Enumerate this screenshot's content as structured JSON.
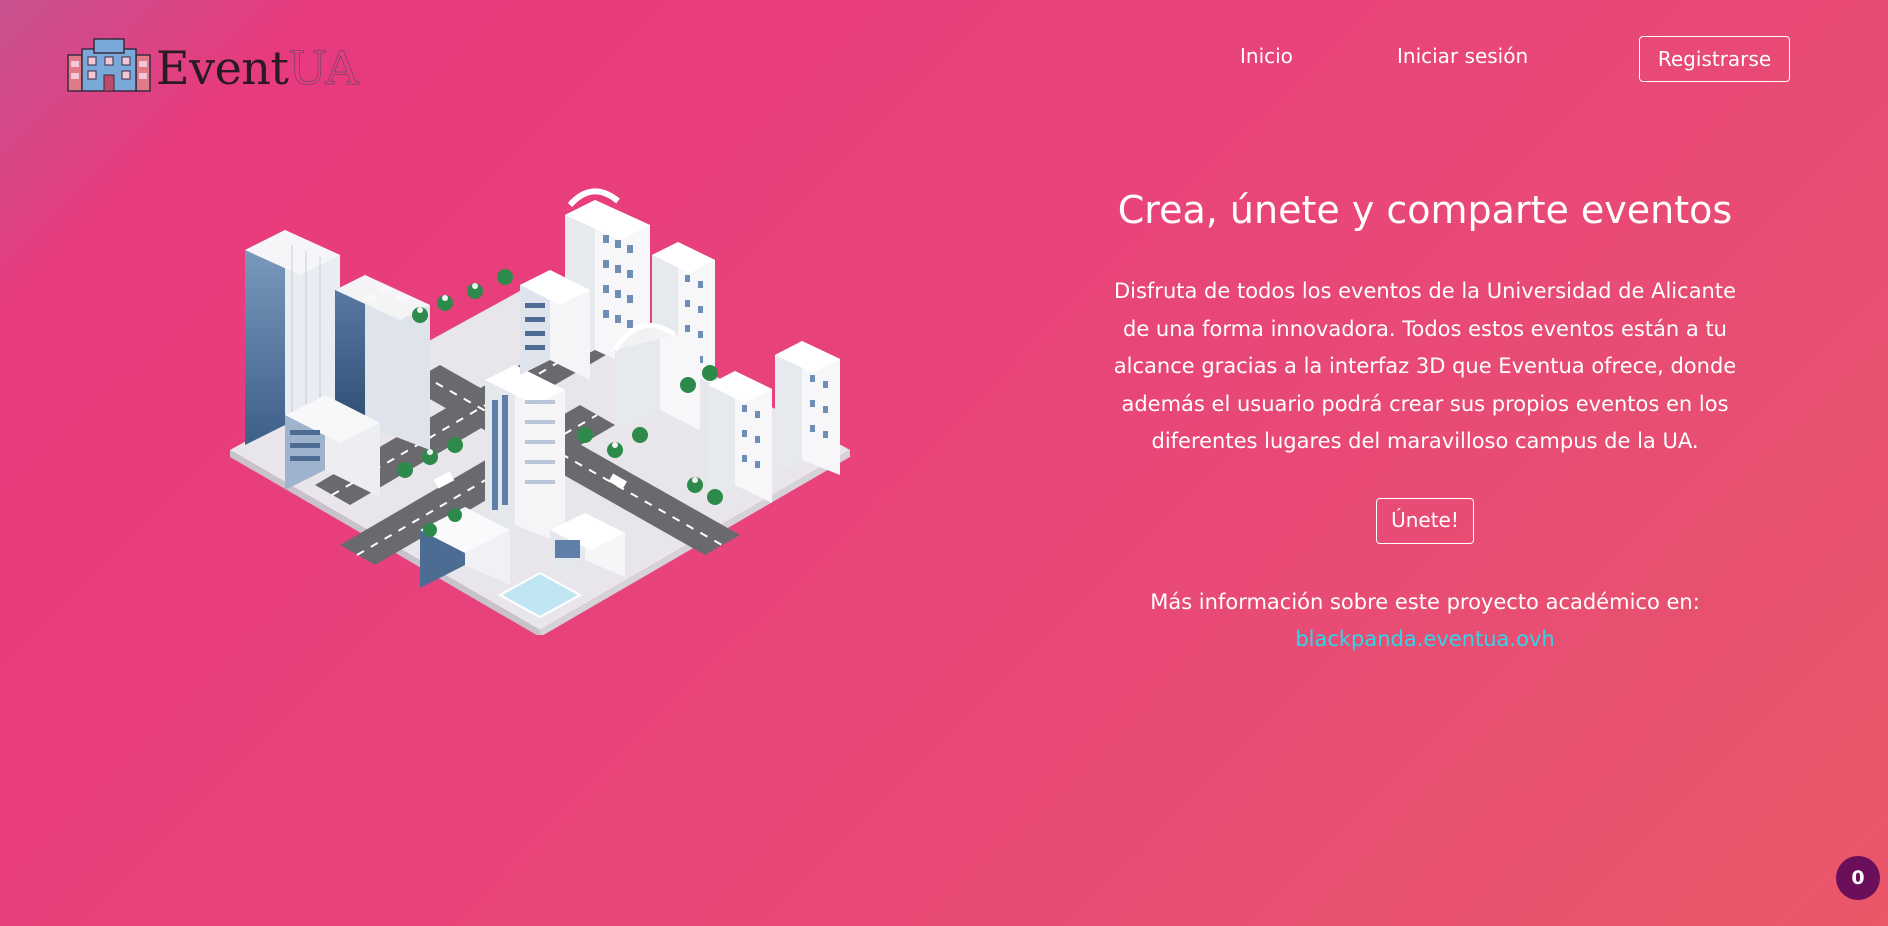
{
  "header": {
    "logo_text_main": "Event",
    "logo_text_accent": "UA",
    "nav": {
      "home_label": "Inicio",
      "login_label": "Iniciar sesión",
      "register_label": "Registrarse"
    }
  },
  "hero": {
    "title": "Crea, únete y comparte eventos",
    "description": "Disfruta de todos los eventos de la Universidad de Alicante de una forma innovadora. Todos estos eventos están a tu alcance gracias a la interfaz 3D que Eventua ofrece, donde además el usuario podrá crear sus propios eventos en los diferentes lugares del maravilloso campus de la UA.",
    "join_label": "Únete!",
    "more_info_text": "Más información sobre este proyecto académico en:",
    "more_info_link": "blackpanda.eventua.ovh"
  },
  "badge": {
    "count": "0"
  },
  "colors": {
    "background_start": "#e83a7e",
    "background_end": "#ea5768",
    "link": "#2fd6e8",
    "badge": "#6b0f5a"
  },
  "icons": {
    "logo": "building-logo-icon",
    "illustration": "isometric-city-illustration"
  }
}
